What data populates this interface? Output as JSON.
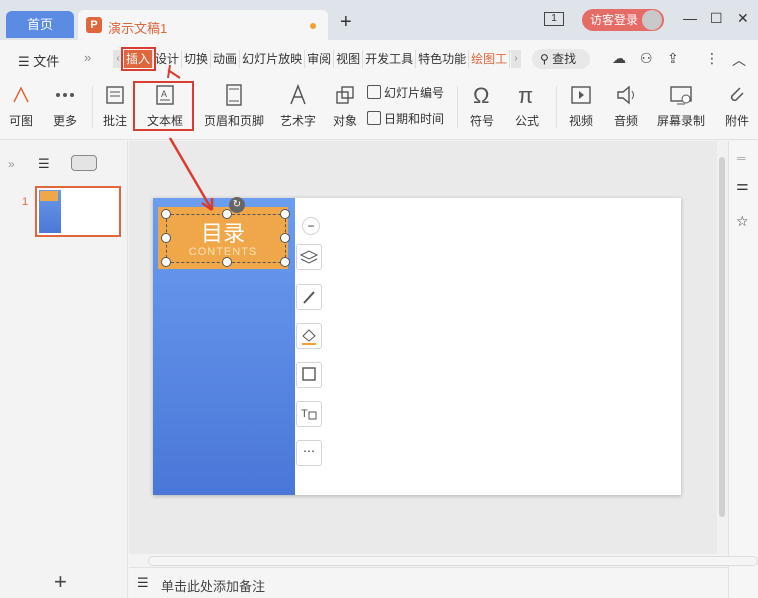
{
  "titlebar": {
    "home_tab": "首页",
    "doc_tab": "演示文稿1",
    "new_tab": "+",
    "window_count": "1",
    "login": "访客登录"
  },
  "menu": {
    "file": "文件",
    "more": "»",
    "tabs": [
      "插入",
      "设计",
      "切换",
      "动画",
      "幻灯片放映",
      "审阅",
      "视图",
      "开发工具",
      "特色功能",
      "绘图工"
    ],
    "active_tab": "插入",
    "search": "查找"
  },
  "ribbon": {
    "items": [
      "可图",
      "更多",
      "批注",
      "文本框",
      "页眉和页脚",
      "艺术字",
      "对象",
      "幻灯片编号",
      "日期和时间",
      "符号",
      "公式",
      "视频",
      "音频",
      "屏幕录制",
      "附件"
    ],
    "highlighted": "文本框"
  },
  "panel": {
    "slide_number": "1",
    "add_slide": "+"
  },
  "slide": {
    "title": "目录",
    "subtitle": "CONTENTS"
  },
  "notes": {
    "placeholder": "单击此处添加备注"
  },
  "colors": {
    "accent": "#e0663d",
    "highlight_red": "#d93c31",
    "slide_blue": "#5b8be3",
    "slide_orange": "#f0a74a"
  }
}
